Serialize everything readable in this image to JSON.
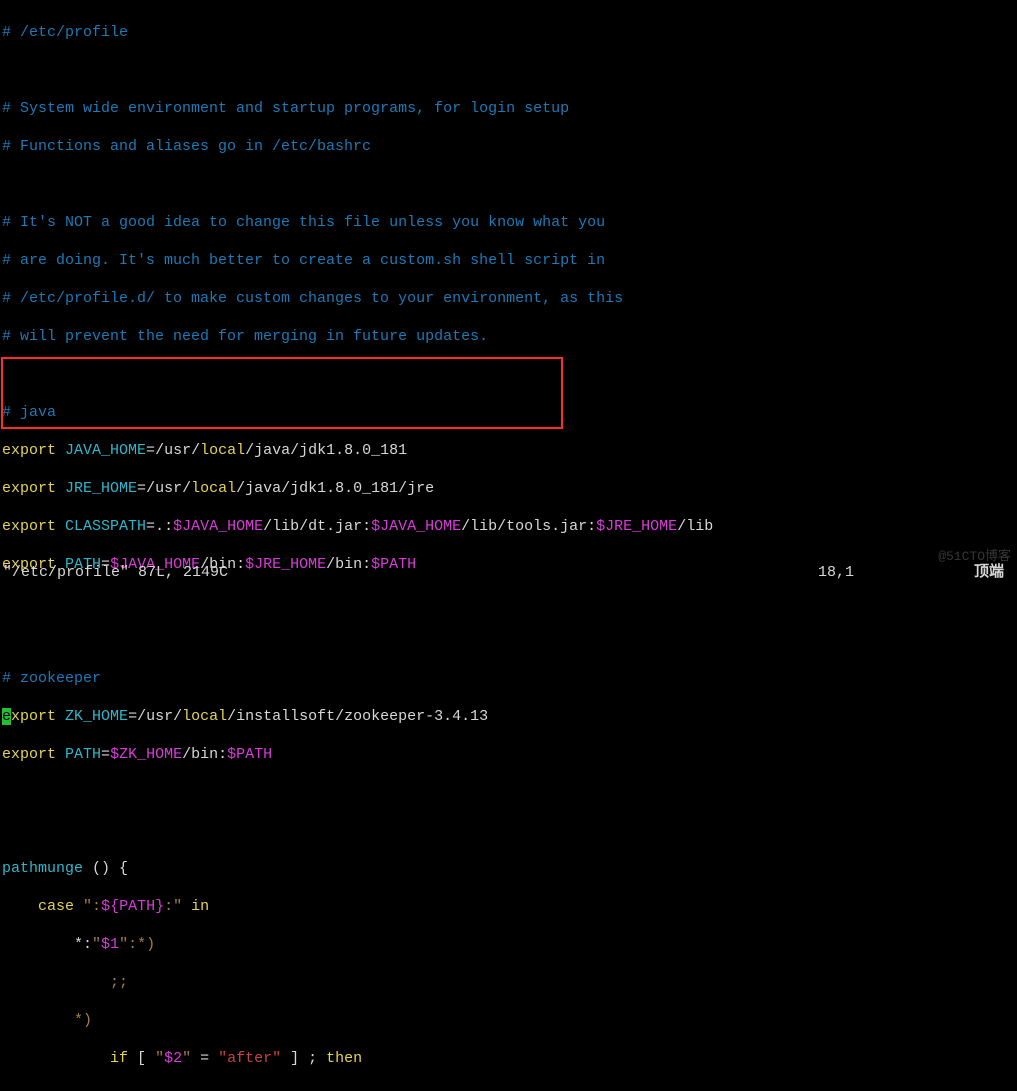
{
  "file": {
    "comment_header": "# /etc/profile",
    "comment_block1_l1": "# System wide environment and startup programs, for login setup",
    "comment_block1_l2": "# Functions and aliases go in /etc/bashrc",
    "comment_block2_l1": "# It's NOT a good idea to change this file unless you know what you",
    "comment_block2_l2": "# are doing. It's much better to create a custom.sh shell script in",
    "comment_block2_l3": "# /etc/profile.d/ to make custom changes to your environment, as this",
    "comment_block2_l4": "# will prevent the need for merging in future updates.",
    "java_section_comment": "# java",
    "zk_section_comment": "# zookeeper"
  },
  "tokens": {
    "export": "export",
    "case": "case",
    "in": "in",
    "if": "if",
    "then": "then",
    "semi": ";;",
    "eq": "=",
    "lbrace": "{",
    "rbrace": "}",
    "lparen": "(",
    "rparen": ")",
    "lbracket": "[",
    "rbracket": "]"
  },
  "java": {
    "home_var": "JAVA_HOME",
    "home_val_pre": "/usr/",
    "local_seg": "local",
    "home_val_post": "/java/jdk1.8.0_181",
    "jre_var": "JRE_HOME",
    "jre_val_post": "/java/jdk1.8.0_181/jre",
    "classpath_var": "CLASSPATH",
    "classpath_lead": ".:",
    "classpath_mid1": "/lib/dt.jar:",
    "classpath_mid2": "/lib/tools.jar:",
    "classpath_tail": "/lib",
    "path_var": "PATH",
    "bin_seg": "/bin:",
    "dollar_java_home": "$JAVA_HOME",
    "dollar_jre_home": "$JRE_HOME",
    "dollar_path": "$PATH"
  },
  "zk": {
    "home_var": "ZK_HOME",
    "home_val_pre": "/usr/",
    "home_val_post": "/installsoft/zookeeper-3.4.13",
    "dollar_zk_home": "$ZK_HOME",
    "bin_seg": "/bin:"
  },
  "func": {
    "name": "pathmunge",
    "empty_parens": " () ",
    "case_prefix": "\":",
    "case_var": "${PATH}",
    "case_suffix": ":\"",
    "pat1_pre": "*:",
    "pat1_q": "\"",
    "pat1_v": "$1",
    "pat1_post": "\":*)",
    "pat2": "*)",
    "if_test_open": " [ ",
    "if_arg_q": "\"",
    "if_arg_v": "$2",
    "if_eq": " = ",
    "if_rhs": "\"after\"",
    "if_test_close": " ] ; "
  },
  "status": {
    "left": "\"/etc/profile\" 87L, 2149C",
    "pos": "18,1",
    "right": "顶端"
  },
  "watermark": "@51CTO博客"
}
